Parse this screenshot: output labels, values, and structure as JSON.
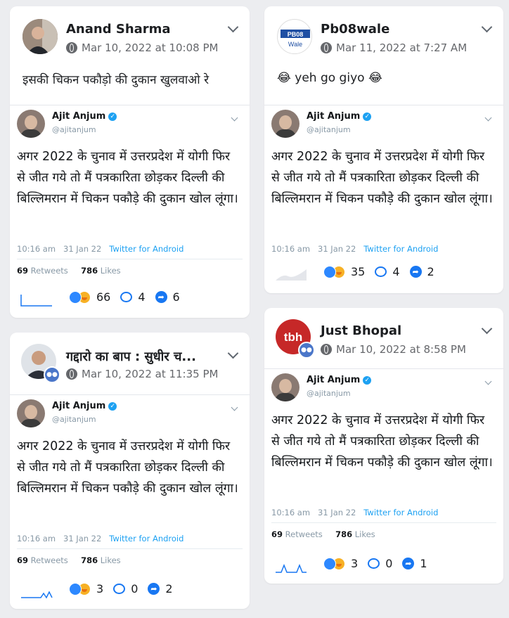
{
  "colors": {
    "like": "#2d88ff",
    "care": "#f7b125",
    "twitter_blue": "#1da1f2",
    "fb_blue": "#1877f2",
    "background": "#ecedf0"
  },
  "tweet": {
    "name": "Ajit Anjum",
    "handle": "@ajitanjum",
    "text": "अगर 2022 के चुनाव में उत्तरप्रदेश में योगी फिर से जीत गये तो मैं पत्रकारिता छोड़कर दिल्ली की बिल्लिमरान में चिकन पकौड़े की दुकान खोल लूंगा।",
    "time": "10:16 am",
    "date": "31 Jan 22",
    "source": "Twitter for Android",
    "retweets": "69",
    "retweets_label": "Retweets",
    "likes": "786",
    "likes_label": "Likes"
  },
  "posts": [
    {
      "author": "Anand Sharma",
      "timestamp": "Mar 10, 2022 at 10:08 PM",
      "caption": "इसकी चिकन पकौड़ो की दुकान खुलवाओ रे",
      "reactions": "66",
      "comments": "4",
      "shares": "6",
      "avatar_icon": "person-photo-icon"
    },
    {
      "author": "Pb08wale",
      "timestamp": "Mar 11, 2022 at 7:27 AM",
      "caption": "😂 yeh go giyo 😂",
      "reactions": "35",
      "comments": "4",
      "shares": "2",
      "avatar_logo_top": "PB08",
      "avatar_logo_bottom": "Wale"
    },
    {
      "author": "गद्दारो का बाप : सुधीर च...",
      "timestamp": "Mar 10, 2022 at 11:35 PM",
      "caption": "",
      "reactions": "3",
      "comments": "0",
      "shares": "2",
      "avatar_icon": "person-photo-icon"
    },
    {
      "author": "Just Bhopal",
      "timestamp": "Mar 10, 2022 at 8:58 PM",
      "caption": "",
      "reactions": "3",
      "comments": "0",
      "shares": "1",
      "avatar_logo_top": "tbh"
    }
  ]
}
